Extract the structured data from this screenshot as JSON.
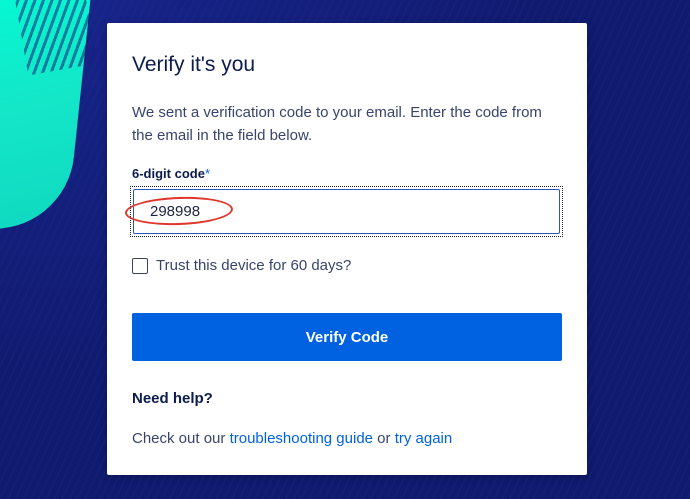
{
  "verify": {
    "title": "Verify it's you",
    "description": "We sent a verification code to your email. Enter the code from the email in the field below.",
    "code_label": "6-digit code",
    "required_marker": "*",
    "code_value": "298998",
    "trust_label": "Trust this device for 60 days?",
    "trust_checked": false,
    "submit_label": "Verify Code"
  },
  "help": {
    "heading": "Need help?",
    "text_prefix": "Check out our ",
    "troubleshooting_link": "troubleshooting guide",
    "text_middle": " or ",
    "try_again_link": "try again"
  },
  "colors": {
    "background": "#101a6e",
    "accent_teal": "#00ffd8",
    "primary_blue": "#0062e0",
    "heading_text": "#0b1b4d",
    "annotation_red": "#e0352b"
  }
}
